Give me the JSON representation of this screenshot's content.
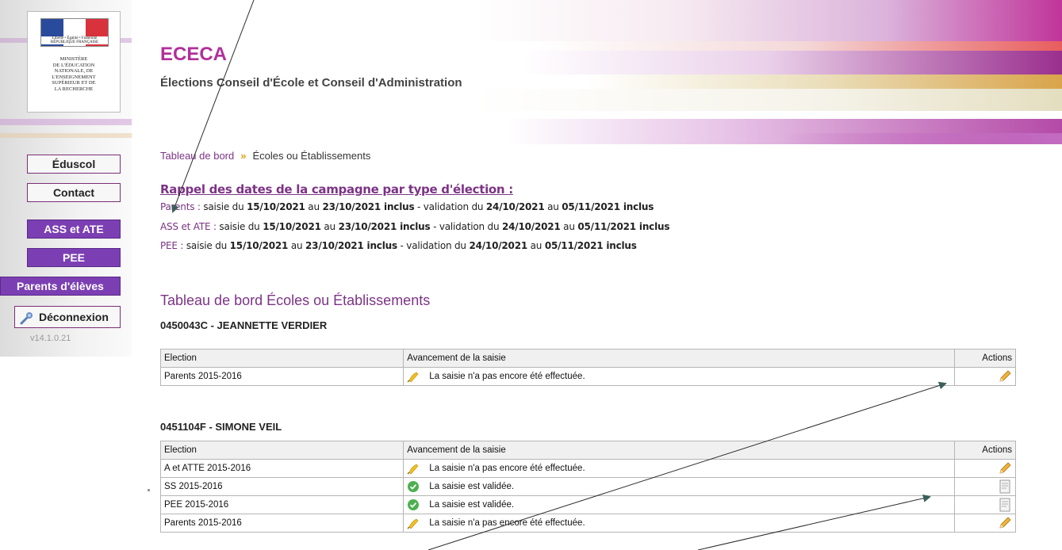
{
  "header": {
    "app_title": "ECECA",
    "app_subtitle": "Élections Conseil d'École et Conseil d'Administration",
    "logo": {
      "republic": "Liberté • Égalité • Fraternité RÉPUBLIQUE FRANÇAISE",
      "ministry_lines": [
        "MINISTÈRE",
        "DE L'ÉDUCATION",
        "NATIONALE, DE",
        "L'ENSEIGNEMENT",
        "SUPÉRIEUR ET DE",
        "LA RECHERCHE"
      ]
    }
  },
  "nav": {
    "items": [
      {
        "label": "Éduscol",
        "style": "light"
      },
      {
        "label": "Contact",
        "style": "light"
      },
      {
        "label": "ASS et ATE",
        "style": "purple"
      },
      {
        "label": "PEE",
        "style": "purple"
      },
      {
        "label": "Parents d'élèves",
        "style": "purple"
      }
    ],
    "logout_label": "Déconnexion",
    "version": "v14.1.0.21"
  },
  "breadcrumb": {
    "root": "Tableau de bord",
    "current": "Écoles ou Établissements"
  },
  "reminder": {
    "title": "Rappel des dates de la campagne par type d'élection :",
    "lines": [
      {
        "label": "Parents :",
        "t1": " saisie du ",
        "d1": "15/10/2021",
        "t2": " au ",
        "d2": "23/10/2021 inclus",
        "t3": " - validation du ",
        "d3": "24/10/2021",
        "t4": " au ",
        "d4": "05/11/2021 inclus"
      },
      {
        "label": "ASS et ATE :",
        "t1": " saisie du ",
        "d1": "15/10/2021",
        "t2": " au ",
        "d2": "23/10/2021 inclus",
        "t3": " - validation du ",
        "d3": "24/10/2021",
        "t4": " au ",
        "d4": "05/11/2021 inclus"
      },
      {
        "label": "PEE :",
        "t1": " saisie du ",
        "d1": "15/10/2021",
        "t2": " au ",
        "d2": "23/10/2021 inclus",
        "t3": " - validation du ",
        "d3": "24/10/2021",
        "t4": " au ",
        "d4": "05/11/2021 inclus"
      }
    ]
  },
  "dashboard": {
    "title": "Tableau de bord Écoles ou Établissements",
    "columns": {
      "election": "Election",
      "progress": "Avancement de la saisie",
      "actions": "Actions"
    },
    "schools": [
      {
        "title": "0450043C - JEANNETTE VERDIER",
        "rows": [
          {
            "election": "Parents 2015-2016",
            "status_icon": "broom-icon",
            "status": "La saisie n'a pas encore été effectuée.",
            "action_icon": "pencil-icon"
          }
        ]
      },
      {
        "title": "0451104F - SIMONE VEIL",
        "rows": [
          {
            "election": "A et ATTE 2015-2016",
            "status_icon": "broom-icon",
            "status": "La saisie n'a pas encore été effectuée.",
            "action_icon": "pencil-icon"
          },
          {
            "election": "SS 2015-2016",
            "status_icon": "check-icon",
            "status": "La saisie est validée.",
            "action_icon": "document-icon"
          },
          {
            "election": "PEE 2015-2016",
            "status_icon": "check-icon",
            "status": "La saisie est validée.",
            "action_icon": "document-icon"
          },
          {
            "election": "Parents 2015-2016",
            "status_icon": "broom-icon",
            "status": "La saisie n'a pas encore été effectuée.",
            "action_icon": "pencil-icon"
          }
        ]
      }
    ]
  },
  "colors": {
    "accent": "#7c3385",
    "title": "#b22f9a",
    "nav_purple": "#7b3fb3",
    "check_green": "#4caf50"
  }
}
